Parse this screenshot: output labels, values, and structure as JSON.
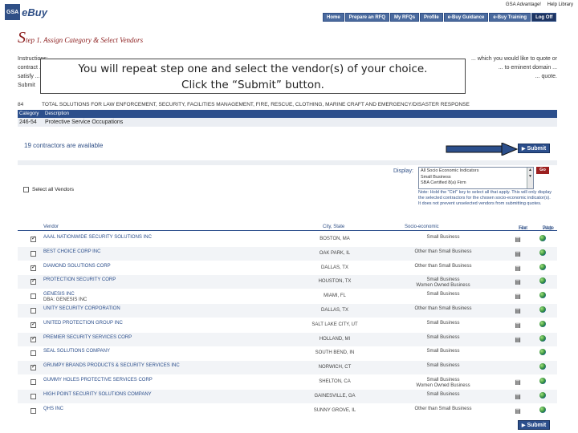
{
  "header": {
    "logo_box": "GSA",
    "logo_text": "eBuy",
    "top_links": [
      "GSA Advantage!",
      "Help Library"
    ],
    "nav": [
      "Home",
      "Prepare an RFQ",
      "My RFQs",
      "Profile",
      "e-Buy Guidance",
      "e-Buy Training",
      "Log Off"
    ]
  },
  "page": {
    "step_big": "S",
    "step_rest": "tep 1. Assign Category & Select Vendors"
  },
  "instructions": {
    "lines": [
      [
        "Instructions: ...",
        "... which you would like to quote or"
      ],
      [
        "contract ...",
        "... to eminent domain ..."
      ],
      [
        "satisfy ...",
        "... quote."
      ],
      [
        "Submit",
        ""
      ]
    ]
  },
  "callout": {
    "line1": "You will repeat step one and select the vendor(s) of your choice.",
    "line2": "Click the “Submit” button."
  },
  "schedule": {
    "code": "84",
    "text": "TOTAL SOLUTIONS FOR LAW ENFORCEMENT, SECURITY, FACILITIES MANAGEMENT, FIRE, RESCUE, CLOTHING, MARINE CRAFT AND EMERGENCY/DISASTER RESPONSE"
  },
  "category_table": {
    "headers": [
      "Category",
      "Description"
    ],
    "row": [
      "246-54",
      "Protective Service Occupations"
    ]
  },
  "contractors_text": "19 contractors are available",
  "submit_label": "Submit",
  "display": {
    "label": "Display:",
    "options": [
      "All Socio Economic Indicators",
      "Small Business",
      "SBA Certified 8(a) Firm"
    ],
    "go_label": "Go",
    "note": "Note: Hold the \"Ctrl\" key to select all that apply. This will only display the selected contractors for the chosen socio-economic indicator(s). It does not prevent unselected vendors from submitting quotes."
  },
  "select_all_label": "Select all Vendors",
  "vendor_table": {
    "headers": {
      "vendor": "Vendor",
      "city": "City, State",
      "socio": "Socio-economic",
      "file_line1": "Text",
      "file_line2": "File",
      "web_line1": "Web",
      "web_line2": "Page"
    },
    "rows": [
      {
        "name": "AAAL NATIONWIDE SECURITY SOLUTIONS INC",
        "name2": "",
        "city": "BOSTON, MA",
        "socio": "Small Business",
        "socio2": "",
        "checked": true,
        "file": true,
        "web": true
      },
      {
        "name": "BEST CHOICE CORP INC",
        "name2": "",
        "city": "OAK PARK, IL",
        "socio": "Other than Small Business",
        "socio2": "",
        "checked": false,
        "file": true,
        "web": true
      },
      {
        "name": "DIAMOND SOLUTIONS CORP",
        "name2": "",
        "city": "DALLAS, TX",
        "socio": "Other than Small Business",
        "socio2": "",
        "checked": true,
        "file": true,
        "web": true
      },
      {
        "name": "PROTECTION SECURITY CORP",
        "name2": "",
        "city": "HOUSTON, TX",
        "socio": "Small Business",
        "socio2": "Women Owned Business",
        "checked": true,
        "file": true,
        "web": true
      },
      {
        "name": "GENESIS INC",
        "name2": "DBA: GENESIS INC",
        "city": "MIAMI, FL",
        "socio": "Small Business",
        "socio2": "",
        "checked": false,
        "file": true,
        "web": true
      },
      {
        "name": "UNITY SECURITY CORPORATION",
        "name2": "",
        "city": "DALLAS, TX",
        "socio": "Other than Small Business",
        "socio2": "",
        "checked": false,
        "file": true,
        "web": true
      },
      {
        "name": "UNITED PROTECTION GROUP INC",
        "name2": "",
        "city": "SALT LAKE CITY, UT",
        "socio": "Small Business",
        "socio2": "",
        "checked": true,
        "file": true,
        "web": true
      },
      {
        "name": "PREMIER SECURITY SERVICES CORP",
        "name2": "",
        "city": "HOLLAND, MI",
        "socio": "Small Business",
        "socio2": "",
        "checked": true,
        "file": true,
        "web": true
      },
      {
        "name": "SEAL SOLUTIONS COMPANY",
        "name2": "",
        "city": "SOUTH BEND, IN",
        "socio": "Small Business",
        "socio2": "",
        "checked": false,
        "file": false,
        "web": true
      },
      {
        "name": "GRUMPY BRANDS PRODUCTS & SECURITY SERVICES INC",
        "name2": "",
        "city": "NORWICH, CT",
        "socio": "Small Business",
        "socio2": "",
        "checked": true,
        "file": false,
        "web": true
      },
      {
        "name": "GUMMY HOLES PROTECTIVE SERVICES CORP",
        "name2": "",
        "city": "SHELTON, CA",
        "socio": "Small Business",
        "socio2": "Women Owned Business",
        "checked": false,
        "file": true,
        "web": true
      },
      {
        "name": "HIGH POINT SECURITY SOLUTIONS COMPANY",
        "name2": "",
        "city": "GAINESVILLE, GA",
        "socio": "Small Business",
        "socio2": "",
        "checked": false,
        "file": true,
        "web": true
      },
      {
        "name": "QHS INC",
        "name2": "",
        "city": "SUNNY GROVE, IL",
        "socio": "Other than Small Business",
        "socio2": "",
        "checked": false,
        "file": true,
        "web": true
      }
    ]
  },
  "colors": {
    "brand_blue": "#2c4f8c",
    "step_red": "#8b1c1c",
    "go_red": "#9c2020"
  }
}
